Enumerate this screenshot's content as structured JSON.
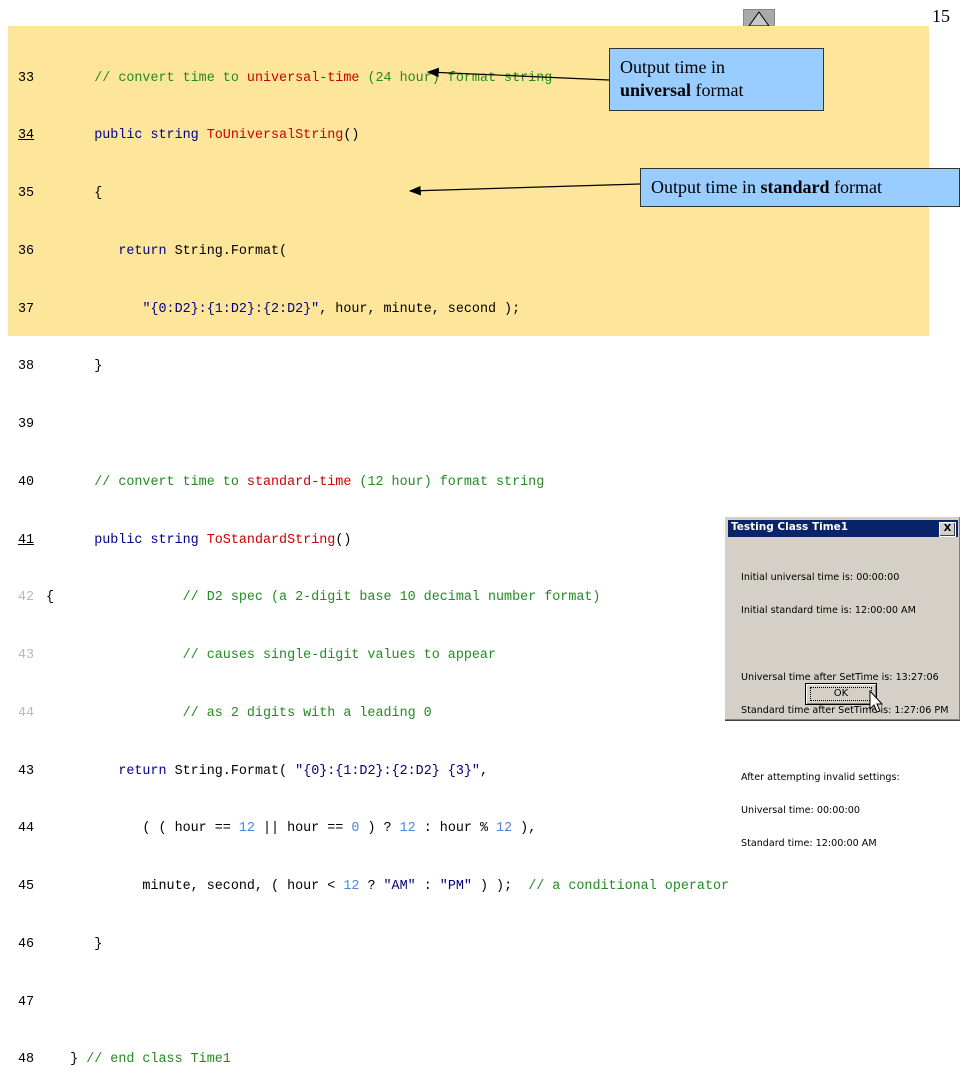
{
  "slide": {
    "number": "15"
  },
  "code": {
    "lines": [
      {
        "n": "33",
        "t": "      // convert time to universal-time (24 hour) format string"
      },
      {
        "n": "34",
        "t": "      public string ToUniversalString()"
      },
      {
        "n": "35",
        "t": "      {"
      },
      {
        "n": "36",
        "t": "         return String.Format("
      },
      {
        "n": "37",
        "t": "            \"{0:D2}:{1:D2}:{2:D2}\", hour, minute, second );"
      },
      {
        "n": "38",
        "t": "      }"
      },
      {
        "n": "39",
        "t": ""
      },
      {
        "n": "40",
        "t": "      // convert time to standard-time (12 hour) format string"
      },
      {
        "n": "41",
        "t": "      public string ToStandardString()"
      },
      {
        "n": "42",
        "t": "{                // D2 spec (a 2-digit base 10 decimal number format)"
      },
      {
        "n": "43",
        "t": "                 // causes single-digit values to appear"
      },
      {
        "n": "44",
        "t": "                 // as 2 digits with a leading 0"
      },
      {
        "n": "43",
        "t": "         return String.Format( \"{0}:{1:D2}:{2:D2} {3}\","
      },
      {
        "n": "44",
        "t": "            ( ( hour == 12 || hour == 0 ) ? 12 : hour % 12 ),"
      },
      {
        "n": "45",
        "t": "            minute, second, ( hour < 12 ? \"AM\" : \"PM\" ) );  // a conditional operator"
      },
      {
        "n": "46",
        "t": "      }"
      },
      {
        "n": "47",
        "t": ""
      },
      {
        "n": "48",
        "t": "   } // end class Time1"
      }
    ]
  },
  "callouts": {
    "universal": {
      "text_pre": "Output time in",
      "bold": "universal",
      "text_post": " format"
    },
    "standard": {
      "text_pre": "Output time in ",
      "bold": "standard",
      "text_post": " format"
    }
  },
  "dialog": {
    "title": "Testing Class Time1",
    "close": "X",
    "lines": [
      "Initial universal time is: 00:00:00",
      "Initial standard time is: 12:00:00 AM",
      "",
      "Universal time after SetTime is: 13:27:06",
      "Standard time after SetTime is: 1:27:06 PM",
      "",
      "After attempting invalid settings:",
      "Universal time: 00:00:00",
      "Standard time: 12:00:00 AM"
    ],
    "ok_label": "OK"
  },
  "colors": {
    "code_background": "#fde59a",
    "callout_background": "#99ccff",
    "comment": "#228b22",
    "keyword": "#00008b",
    "method_name": "#cc0000",
    "number": "#4b86e0",
    "titlebar": "#0a246a"
  },
  "icons": {
    "slide_nav": "up-arrow-icon",
    "cursor": "mouse-pointer-icon"
  }
}
